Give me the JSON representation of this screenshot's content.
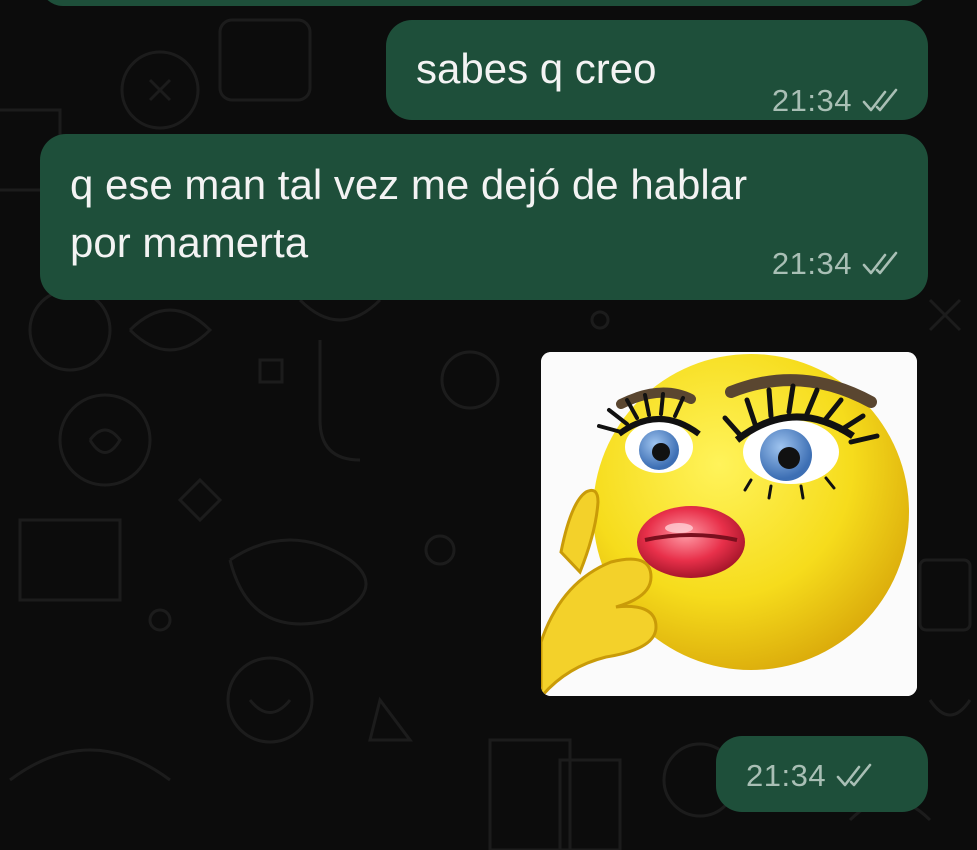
{
  "chat": {
    "messages": [
      {
        "direction": "outgoing",
        "text": "sabes q creo",
        "time": "21:34",
        "status": "read-ticks-icon"
      },
      {
        "direction": "outgoing",
        "text": "q ese man tal vez me dejó de hablar\npor mamerta",
        "time": "21:34",
        "status": "read-ticks-icon"
      },
      {
        "direction": "outgoing",
        "type": "sticker",
        "sticker": "kissing-lips-emoji-sticker",
        "time": "21:34",
        "status": "read-ticks-icon"
      }
    ]
  },
  "colors": {
    "background": "#0c0c0c",
    "bubble_outgoing": "#1e4f3a",
    "text": "#f3f3f3",
    "meta_text": "#a9bfb5"
  }
}
